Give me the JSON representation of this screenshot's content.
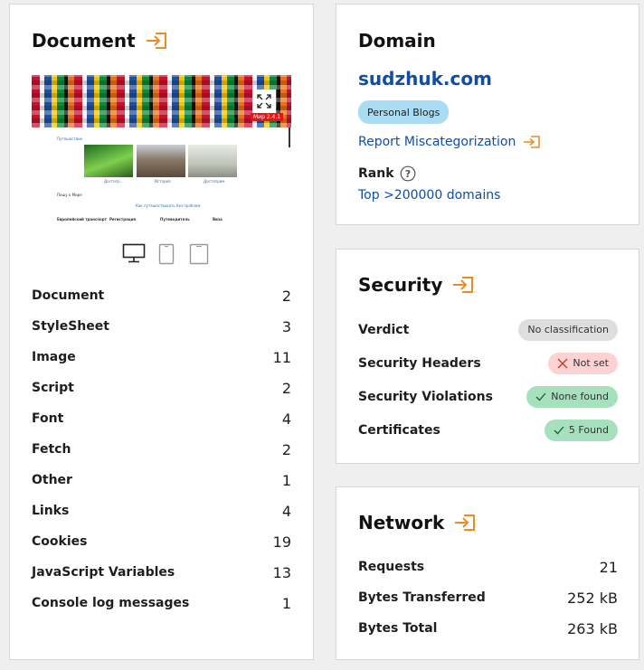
{
  "document_card": {
    "title": "Document",
    "preview": {
      "nav_link": "Путешествие",
      "badge": "Мир 2.4.1",
      "photo_captions": [
        "Достопр.",
        "История",
        "Достоприм."
      ],
      "text_line_1": "Пишу о Мире",
      "text_line_2": "Как путешествовать без проблем",
      "footer": [
        "Европейский транспорт",
        "Регистрация",
        "Путеводитель",
        "Виза"
      ]
    },
    "devices": [
      "desktop-icon",
      "tablet-icon",
      "phone-icon"
    ],
    "stats": [
      {
        "label": "Document",
        "value": "2"
      },
      {
        "label": "StyleSheet",
        "value": "3"
      },
      {
        "label": "Image",
        "value": "11"
      },
      {
        "label": "Script",
        "value": "2"
      },
      {
        "label": "Font",
        "value": "4"
      },
      {
        "label": "Fetch",
        "value": "2"
      },
      {
        "label": "Other",
        "value": "1"
      },
      {
        "label": "Links",
        "value": "4"
      },
      {
        "label": "Cookies",
        "value": "19"
      },
      {
        "label": "JavaScript Variables",
        "value": "13"
      },
      {
        "label": "Console log messages",
        "value": "1"
      }
    ]
  },
  "domain_card": {
    "title": "Domain",
    "domain": "sudzhuk.com",
    "category": "Personal Blogs",
    "report_label": "Report Miscategorization",
    "rank_label": "Rank",
    "rank_value": "Top >200000 domains"
  },
  "security_card": {
    "title": "Security",
    "rows": [
      {
        "label": "Verdict",
        "badge": "No classification",
        "status": "neutral"
      },
      {
        "label": "Security Headers",
        "badge": "Not set",
        "status": "bad"
      },
      {
        "label": "Security Violations",
        "badge": "None found",
        "status": "good"
      },
      {
        "label": "Certificates",
        "badge": "5 Found",
        "status": "good"
      }
    ]
  },
  "network_card": {
    "title": "Network",
    "rows": [
      {
        "label": "Requests",
        "value": "21"
      },
      {
        "label": "Bytes Transferred",
        "value": "252 kB"
      },
      {
        "label": "Bytes Total",
        "value": "263 kB"
      }
    ]
  },
  "colors": {
    "accent_orange": "#f08a24",
    "link_blue": "#0f4ea3",
    "category_badge": "#a9dcf2",
    "badge_neutral": "#dedede",
    "badge_bad": "#fdd2d2",
    "badge_good": "#a7e0bd"
  }
}
